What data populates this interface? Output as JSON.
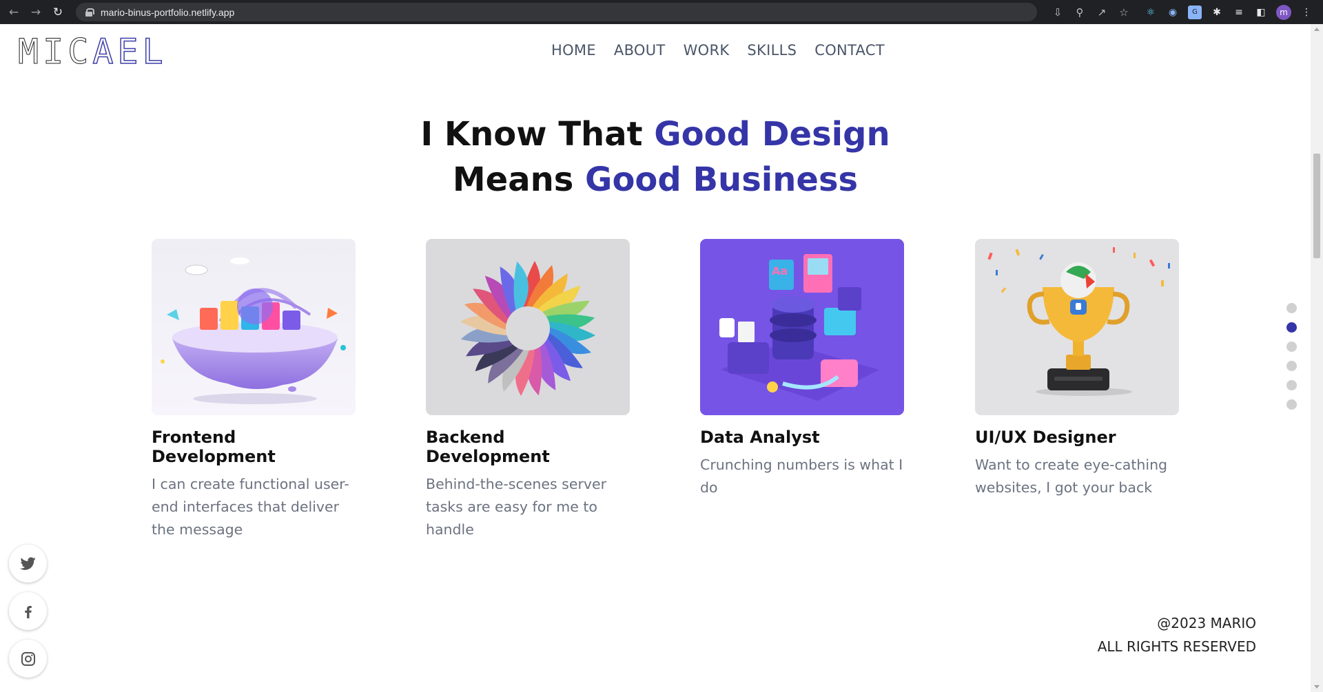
{
  "browser": {
    "url": "mario-binus-portfolio.netlify.app",
    "profile_initial": "m",
    "ext_badge": "G"
  },
  "logo": {
    "part1": "MIC",
    "part2": "AEL"
  },
  "nav": {
    "items": [
      "HOME",
      "ABOUT",
      "WORK",
      "SKILLS",
      "CONTACT"
    ]
  },
  "headline": {
    "line1_plain": "I Know That ",
    "line1_accent": "Good Design",
    "line2_plain": "Means ",
    "line2_accent": "Good Business"
  },
  "services": [
    {
      "title": "Frontend Development",
      "description": "I can create functional user-end interfaces that deliver the message"
    },
    {
      "title": "Backend Development",
      "description": "Behind-the-scenes server tasks are easy for me to handle"
    },
    {
      "title": "Data Analyst",
      "description": "Crunching numbers is what I do"
    },
    {
      "title": "UI/UX Designer",
      "description": "Want to create eye-cathing websites, I got your back"
    }
  ],
  "section_dots": {
    "count": 6,
    "active_index": 1
  },
  "socials": [
    "twitter-icon",
    "facebook-icon",
    "instagram-icon"
  ],
  "footer": {
    "line1": "@2023 MARIO",
    "line2": "ALL RIGHTS RESERVED"
  },
  "colors": {
    "accent": "#3535a8",
    "text_dark": "#111111",
    "text_muted": "#6b7280",
    "data_card_bg": "#7b5ce8"
  }
}
